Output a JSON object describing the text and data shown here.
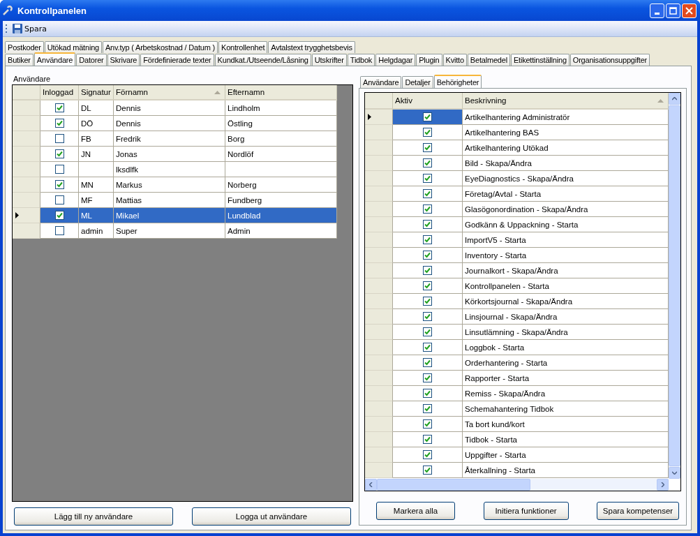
{
  "window": {
    "title": "Kontrollpanelen"
  },
  "toolbar": [
    {
      "label": "Spara"
    }
  ],
  "tabs_row_1": [
    {
      "label": "Postkoder",
      "selected": false
    },
    {
      "label": "Utökad mätning",
      "selected": false
    },
    {
      "label": "Anv.typ ( Arbetskostnad / Datum )",
      "selected": false
    },
    {
      "label": "Kontrollenhet",
      "selected": false
    },
    {
      "label": "Avtalstext trygghetsbevis",
      "selected": false
    }
  ],
  "tabs_row_2": [
    {
      "label": "Butiker",
      "selected": false
    },
    {
      "label": "Användare",
      "selected": true
    },
    {
      "label": "Datorer",
      "selected": false
    },
    {
      "label": "Skrivare",
      "selected": false
    },
    {
      "label": "Fördefinierade texter",
      "selected": false
    },
    {
      "label": "Kundkat./Utseende/Låsning",
      "selected": false
    },
    {
      "label": "Utskrifter",
      "selected": false
    },
    {
      "label": "Tidbok",
      "selected": false
    },
    {
      "label": "Helgdagar",
      "selected": false
    },
    {
      "label": "Plugin",
      "selected": false
    },
    {
      "label": "Kvitto",
      "selected": false
    },
    {
      "label": "Betalmedel",
      "selected": false
    },
    {
      "label": "Etikettinställning",
      "selected": false
    },
    {
      "label": "Organisationsuppgifter",
      "selected": false
    }
  ],
  "users": {
    "title": "Användare",
    "columns": [
      "Inloggad",
      "Signatur",
      "Förnamn",
      "Efternamn"
    ],
    "rows": [
      {
        "logged_in": true,
        "signature": "DL",
        "first_name": "Dennis",
        "last_name": "Lindholm",
        "selected": false
      },
      {
        "logged_in": true,
        "signature": "DÖ",
        "first_name": "Dennis",
        "last_name": "Östling",
        "selected": false
      },
      {
        "logged_in": false,
        "signature": "FB",
        "first_name": "Fredrik",
        "last_name": "Borg",
        "selected": false
      },
      {
        "logged_in": true,
        "signature": "JN",
        "first_name": "Jonas",
        "last_name": "Nordlöf",
        "selected": false
      },
      {
        "logged_in": false,
        "first_name": "lksdlfk",
        "selected": false
      },
      {
        "logged_in": true,
        "signature": "MN",
        "first_name": "Markus",
        "last_name": "Norberg",
        "selected": false
      },
      {
        "logged_in": false,
        "signature": "MF",
        "first_name": "Mattias",
        "last_name": "Fundberg",
        "selected": false
      },
      {
        "logged_in": true,
        "signature": "ML",
        "first_name": "Mikael",
        "last_name": "Lundblad",
        "selected": true
      },
      {
        "logged_in": false,
        "signature": "admin",
        "first_name": "Super",
        "last_name": "Admin",
        "selected": false
      }
    ],
    "buttons": [
      "Lägg till ny användare",
      "Logga ut användare"
    ]
  },
  "detail_tabs": [
    {
      "label": "Användare",
      "selected": false
    },
    {
      "label": "Detaljer",
      "selected": false
    },
    {
      "label": "Behörigheter",
      "selected": true
    }
  ],
  "permissions": {
    "columns": [
      "Aktiv",
      "Beskrivning"
    ],
    "rows": [
      {
        "active": true,
        "description": "Artikelhantering Administratör",
        "selected": true
      },
      {
        "active": true,
        "description": "Artikelhantering BAS",
        "selected": false
      },
      {
        "active": true,
        "description": "Artikelhantering Utökad",
        "selected": false
      },
      {
        "active": true,
        "description": "Bild - Skapa/Ändra",
        "selected": false
      },
      {
        "active": true,
        "description": "EyeDiagnostics - Skapa/Ändra",
        "selected": false
      },
      {
        "active": true,
        "description": "Företag/Avtal - Starta",
        "selected": false
      },
      {
        "active": true,
        "description": "Glasögonordination - Skapa/Ändra",
        "selected": false
      },
      {
        "active": true,
        "description": "Godkänn & Uppackning - Starta",
        "selected": false
      },
      {
        "active": true,
        "description": "ImportV5 - Starta",
        "selected": false
      },
      {
        "active": true,
        "description": "Inventory - Starta",
        "selected": false
      },
      {
        "active": true,
        "description": "Journalkort - Skapa/Ändra",
        "selected": false
      },
      {
        "active": true,
        "description": "Kontrollpanelen - Starta",
        "selected": false
      },
      {
        "active": true,
        "description": "Körkortsjournal - Skapa/Ändra",
        "selected": false
      },
      {
        "active": true,
        "description": "Linsjournal - Skapa/Ändra",
        "selected": false
      },
      {
        "active": true,
        "description": "Linsutlämning - Skapa/Ändra",
        "selected": false
      },
      {
        "active": true,
        "description": "Loggbok - Starta",
        "selected": false
      },
      {
        "active": true,
        "description": "Orderhantering - Starta",
        "selected": false
      },
      {
        "active": true,
        "description": "Rapporter - Starta",
        "selected": false
      },
      {
        "active": true,
        "description": "Remiss - Skapa/Ändra",
        "selected": false
      },
      {
        "active": true,
        "description": "Schemahantering Tidbok",
        "selected": false
      },
      {
        "active": true,
        "description": "Ta bort kund/kort",
        "selected": false
      },
      {
        "active": true,
        "description": "Tidbok - Starta",
        "selected": false
      },
      {
        "active": true,
        "description": "Uppgifter - Starta",
        "selected": false
      },
      {
        "active": true,
        "description": "Återkallning - Starta",
        "selected": false
      }
    ],
    "buttons": [
      "Markera alla",
      "Initiera funktioner",
      "Spara kompetenser"
    ]
  }
}
